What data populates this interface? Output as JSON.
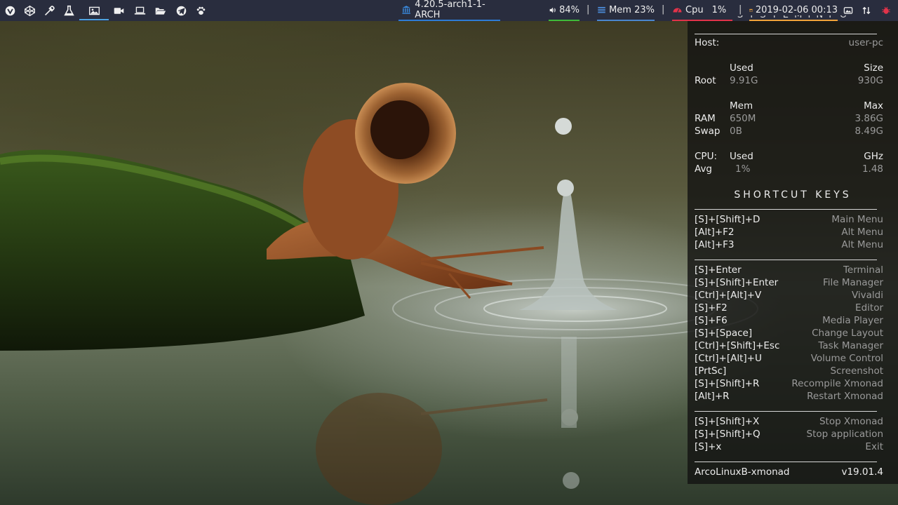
{
  "topbar": {
    "launchers": [
      {
        "icon": "vivaldi-icon"
      },
      {
        "icon": "codepen-icon"
      },
      {
        "icon": "eyedropper-icon"
      },
      {
        "icon": "flask-icon"
      },
      {
        "icon": "image-icon"
      },
      {
        "icon": "video-camera-icon"
      },
      {
        "icon": "laptop-icon"
      },
      {
        "icon": "folder-open-icon"
      },
      {
        "icon": "telegram-icon"
      },
      {
        "icon": "paw-icon"
      }
    ],
    "kernel": "4.20.5-arch1-1-ARCH",
    "volume": "84%",
    "mem": "Mem 23%",
    "cpu_label": "Cpu",
    "cpu_value": "1%",
    "datetime": "2019-02-06 00:13",
    "separator": "|",
    "colors": {
      "bar_bg": "#292d3e",
      "kernel_accent": "#2d7bd6",
      "volume_accent": "#3fba3a",
      "mem_accent": "#4a86cf",
      "cpu_accent": "#e1334a",
      "date_accent": "#f0a33a"
    }
  },
  "conky": {
    "cut_title": "S Y S T E M   I N F O",
    "host_label": "Host:",
    "host_value": "user-pc",
    "disk": {
      "used_header": "Used",
      "size_header": "Size",
      "root_label": "Root",
      "root_used": "9.91G",
      "root_size": "930G"
    },
    "memory": {
      "mem_header": "Mem",
      "max_header": "Max",
      "ram_label": "RAM",
      "ram_used": "650M",
      "ram_max": "3.86G",
      "swap_label": "Swap",
      "swap_used": "0B",
      "swap_max": "8.49G"
    },
    "cpu": {
      "label": "CPU:",
      "used_header": "Used",
      "ghz_header": "GHz",
      "avg_label": "Avg",
      "avg_used": "1%",
      "avg_ghz": "1.48"
    },
    "shortcut_title": "SHORTCUT KEYS",
    "shortcuts_group1": [
      {
        "key": "[S]+[Shift]+D",
        "action": "Main Menu"
      },
      {
        "key": "[Alt]+F2",
        "action": "Alt Menu"
      },
      {
        "key": "[Alt]+F3",
        "action": "Alt Menu"
      }
    ],
    "shortcuts_group2": [
      {
        "key": "[S]+Enter",
        "action": "Terminal"
      },
      {
        "key": "[S]+[Shift]+Enter",
        "action": "File Manager"
      },
      {
        "key": "[Ctrl]+[Alt]+V",
        "action": "Vivaldi"
      },
      {
        "key": "[S]+F2",
        "action": "Editor"
      },
      {
        "key": "[S]+F6",
        "action": "Media Player"
      },
      {
        "key": "[S]+[Space]",
        "action": "Change Layout"
      },
      {
        "key": "[Ctrl]+[Shift]+Esc",
        "action": "Task Manager"
      },
      {
        "key": "[Ctrl]+[Alt]+U",
        "action": "Volume Control"
      },
      {
        "key": "[PrtSc]",
        "action": "Screenshot"
      },
      {
        "key": "[S]+[Shift]+R",
        "action": "Recompile Xmonad"
      },
      {
        "key": "[Alt]+R",
        "action": "Restart Xmonad"
      }
    ],
    "shortcuts_group3": [
      {
        "key": "[S]+[Shift]+X",
        "action": "Stop Xmonad"
      },
      {
        "key": "[S]+[Shift]+Q",
        "action": "Stop application"
      },
      {
        "key": "[S]+x",
        "action": "Exit"
      }
    ],
    "footer_name": "ArcoLinuxB-xmonad",
    "footer_version": "v19.01.4"
  }
}
